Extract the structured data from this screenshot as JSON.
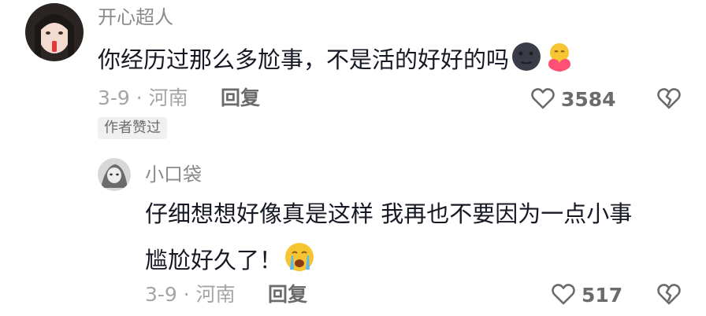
{
  "comment": {
    "username": "开心超人",
    "text": "你经历过那么多尬事，不是活的好好的吗",
    "emojis": [
      "dark-moon-face-emoji",
      "hug-heart-emoji"
    ],
    "date_location": "3-9 · 河南",
    "reply_label": "回复",
    "like_count": "3584",
    "badge": "作者赞过"
  },
  "reply": {
    "username": "小口袋",
    "text_line1": "仔细想想好像真是这样 我再也不要因为一点小事",
    "text_line2": "尴尬好久了！",
    "emojis": [
      "crying-face-emoji"
    ],
    "date_location": "3-9 · 河南",
    "reply_label": "回复",
    "like_count": "517"
  },
  "colors": {
    "text_primary": "#161823",
    "text_secondary": "#8a8a8a",
    "text_meta": "#a5a5a5",
    "badge_bg": "#f0f0f0"
  }
}
